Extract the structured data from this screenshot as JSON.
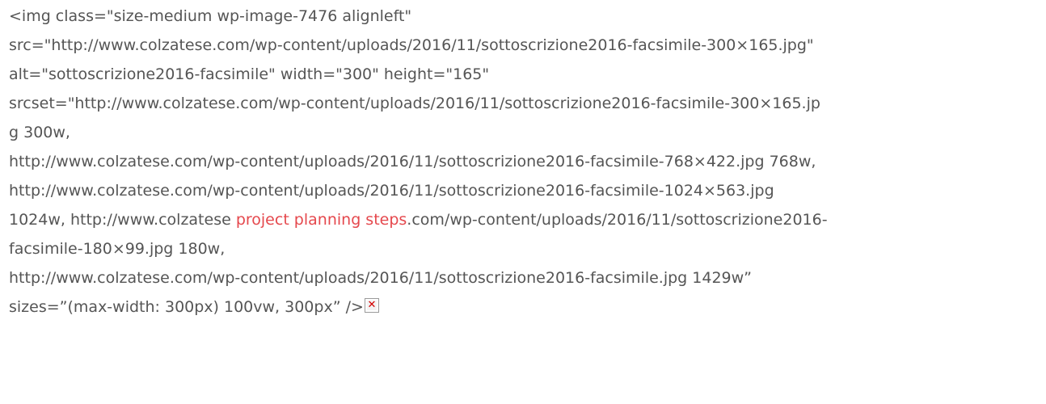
{
  "lines": [
    "<img class=\"size-medium wp-image-7476 alignleft\"",
    "src=\"http://www.colzatese.com/wp-content/uploads/2016/11/sottoscrizione2016-facsimile-300×165.jpg\"",
    "alt=\"sottoscrizione2016-facsimile\" width=\"300\" height=\"165\"",
    "srcset=\"http://www.colzatese.com/wp-content/uploads/2016/11/sottoscrizione2016-facsimile-300×165.jp",
    "g 300w,",
    "http://www.colzatese.com/wp-content/uploads/2016/11/sottoscrizione2016-facsimile-768×422.jpg 768w,",
    "http://www.colzatese.com/wp-content/uploads/2016/11/sottoscrizione2016-facsimile-1024×563.jpg"
  ],
  "line8": {
    "before": "1024w, http://www.colzatese ",
    "link_text": "project planning steps",
    "after": ".com/wp-content/uploads/2016/11/sottoscrizione2016-"
  },
  "line9": "facsimile-180×99.jpg 180w,",
  "line10": "http://www.colzatese.com/wp-content/uploads/2016/11/sottoscrizione2016-facsimile.jpg 1429w”",
  "line11": "sizes=”(max-width: 300px) 100vw, 300px” />",
  "broken_image_icon": "broken-image-icon",
  "colors": {
    "text": "#555555",
    "link": "#e5484d",
    "icon_x": "#d40000"
  }
}
